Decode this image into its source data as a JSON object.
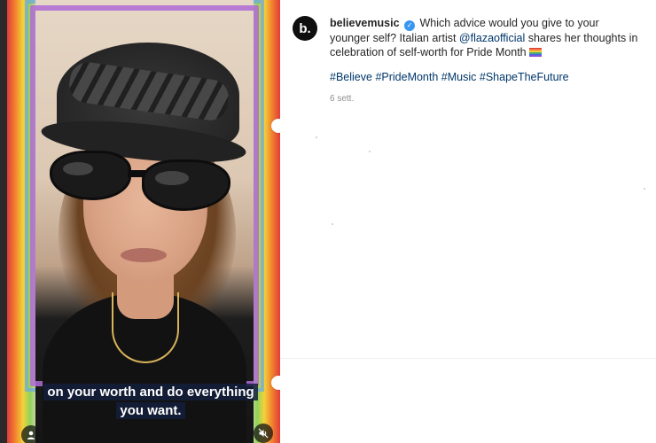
{
  "post": {
    "username": "believemusic",
    "avatar_letter": "b.",
    "caption_start": "Which advice would you give to your younger self? Italian artist ",
    "mention": "@flazaofficial",
    "caption_end": " shares her thoughts in celebration of self-worth for Pride Month",
    "hashtags": [
      "#Believe",
      "#PrideMonth",
      "#Music",
      "#ShapeTheFuture"
    ],
    "time": "6 sett."
  },
  "video": {
    "subtitle": "on your worth and do everything you want."
  },
  "icons": {
    "verified": "verified-badge-icon",
    "user": "user-icon",
    "mute": "muted-speaker-icon"
  },
  "colors": {
    "link": "#00376b",
    "verified": "#3897f0",
    "text": "#262626",
    "meta": "#8e8e8e"
  }
}
